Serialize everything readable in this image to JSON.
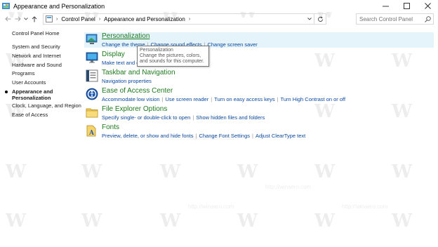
{
  "window": {
    "title": "Appearance and Personalization",
    "minimize_icon": "minimize-icon",
    "maximize_icon": "maximize-icon",
    "close_icon": "close-icon"
  },
  "nav": {
    "back_icon": "back-arrow-icon",
    "forward_icon": "forward-arrow-icon",
    "recent_icon": "chevron-down-icon",
    "up_icon": "up-arrow-icon"
  },
  "address": {
    "crumbs": [
      "Control Panel",
      "Appearance and Personalization"
    ],
    "separator": "›",
    "refresh_icon": "refresh-icon"
  },
  "search": {
    "placeholder": "Search Control Panel",
    "icon": "search-icon"
  },
  "sidebar": {
    "items": [
      {
        "label": "Control Panel Home",
        "current": false
      },
      {
        "label": "System and Security",
        "current": false
      },
      {
        "label": "Network and Internet",
        "current": false
      },
      {
        "label": "Hardware and Sound",
        "current": false
      },
      {
        "label": "Programs",
        "current": false
      },
      {
        "label": "User Accounts",
        "current": false
      },
      {
        "label": "Appearance and",
        "label2": "Personalization",
        "current": true
      },
      {
        "label": "Clock, Language, and Region",
        "current": false
      },
      {
        "label": "Ease of Access",
        "current": false
      }
    ]
  },
  "categories": [
    {
      "title": "Personalization",
      "icon": "personalization-icon",
      "links": [
        "Change the theme",
        "Change sound effects",
        "Change screen saver"
      ]
    },
    {
      "title": "Display",
      "icon": "display-icon",
      "links": [
        "Make text and ot"
      ]
    },
    {
      "title": "Taskbar and Navigation",
      "icon": "taskbar-icon",
      "links": [
        "Navigation properties"
      ]
    },
    {
      "title": "Ease of Access Center",
      "icon": "ease-of-access-icon",
      "links": [
        "Accommodate low vision",
        "Use screen reader",
        "Turn on easy access keys",
        "Turn High Contrast on or off"
      ]
    },
    {
      "title": "File Explorer Options",
      "icon": "file-explorer-icon",
      "links": [
        "Specify single- or double-click to open",
        "Show hidden files and folders"
      ]
    },
    {
      "title": "Fonts",
      "icon": "fonts-icon",
      "links": [
        "Preview, delete, or show and hide fonts",
        "Change Font Settings",
        "Adjust ClearType text"
      ]
    }
  ],
  "tooltip": {
    "title": "Personalization",
    "body": "Change the pictures, colors, and sounds for this computer."
  },
  "watermark": {
    "text": "W",
    "url": "http://winaero.com"
  },
  "colors": {
    "category_title": "#1e7a1e",
    "link": "#0b4aa0",
    "highlight": "#e5f3fb"
  }
}
